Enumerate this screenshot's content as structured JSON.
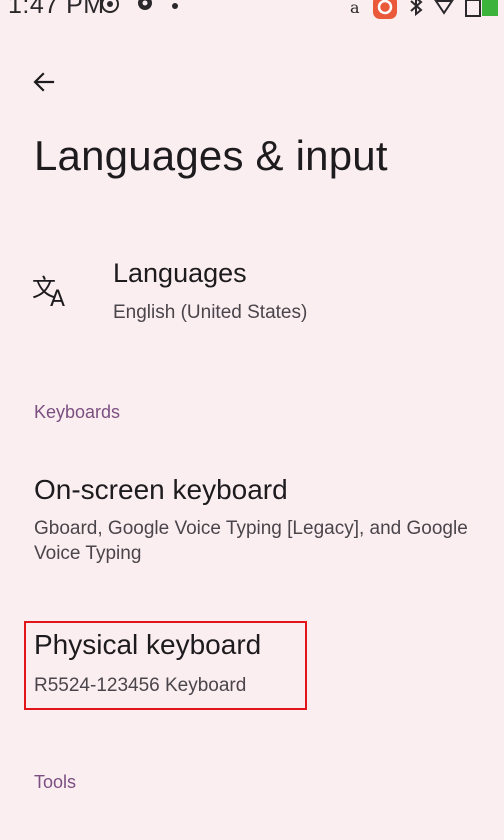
{
  "status_bar": {
    "time": "1:47 PM"
  },
  "header": {
    "back_icon": "arrow-back-icon",
    "title": "Languages & input"
  },
  "languages": {
    "icon": "translate-icon",
    "title": "Languages",
    "summary": "English (United States)"
  },
  "sections": {
    "keyboards_header": "Keyboards",
    "tools_header": "Tools"
  },
  "onscreen_keyboard": {
    "title": "On-screen keyboard",
    "summary": "Gboard, Google Voice Typing [Legacy], and Google Voice Typing"
  },
  "physical_keyboard": {
    "title": "Physical keyboard",
    "summary": "R5524-123456 Keyboard"
  },
  "colors": {
    "background": "#fbeef0",
    "section_header": "#7b4f82",
    "highlight": "#e1161b"
  }
}
